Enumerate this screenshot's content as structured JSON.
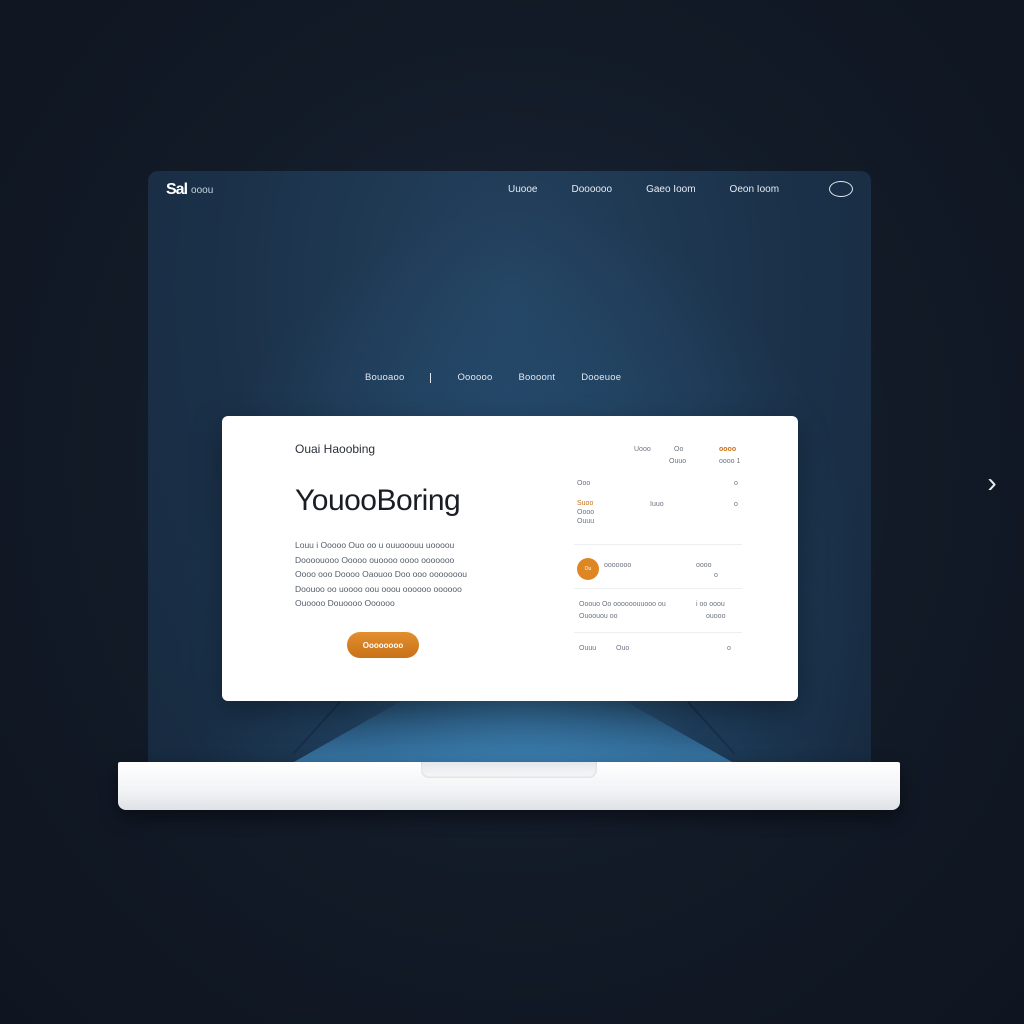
{
  "header": {
    "logo_mark": "Sal",
    "logo_text": "ooou",
    "nav": [
      "Uuooe",
      "Doooooo",
      "Gaeo Ioom",
      "Oeon Ioom"
    ]
  },
  "subnav": [
    "Bouoaoo",
    "Oooooo",
    "Boooont",
    "Dooeuoe"
  ],
  "card": {
    "eyebrow": "Ouai Haoobing",
    "headline": "YouooBoring",
    "body": "Louu i Ooooo Ouo oo u ouuooouu uoooou Doooouooo Ooooo ouoooo oooo ooooooo Oooo ooo Doooo Oaouoo Doo ooo ooooooou Doouoo oo uoooo oou ooou oooooo oooooo Ouoooo Douoooo Oooooo",
    "cta_label": "Oooooooo"
  },
  "panel": {
    "col_a": "Uooo",
    "col_b": "Oo",
    "col_b_sub": "Ouuo",
    "col_c": "oooo",
    "col_c_sub": "oooo 1",
    "row1_a": "Ooo",
    "row1_c": "o",
    "row2_label_1": "Suoo",
    "row2_label_2": "Oooo",
    "row2_label_3": "Ouuu",
    "row2_mid": "Iuuo",
    "row2_c": "o",
    "row3_dot": "Ou",
    "row3_text": "ooooooo",
    "row3_right": "oooo",
    "row3_right_sub": "o",
    "row4_left": "Ooouo Oo oooooouuooo ou",
    "row4_left_sub": "Ouoouou oo",
    "row4_right": "i oo ooou",
    "row4_right_sub": "ouooo",
    "row5_a": "Ouuu",
    "row5_b": "Ouo",
    "row5_right": "o",
    "colors": {
      "accent": "#de8623",
      "text": "#6c7480"
    }
  },
  "icons": {
    "user": "user-circle-icon",
    "next": "chevron-right-icon"
  },
  "next_glyph": "›"
}
